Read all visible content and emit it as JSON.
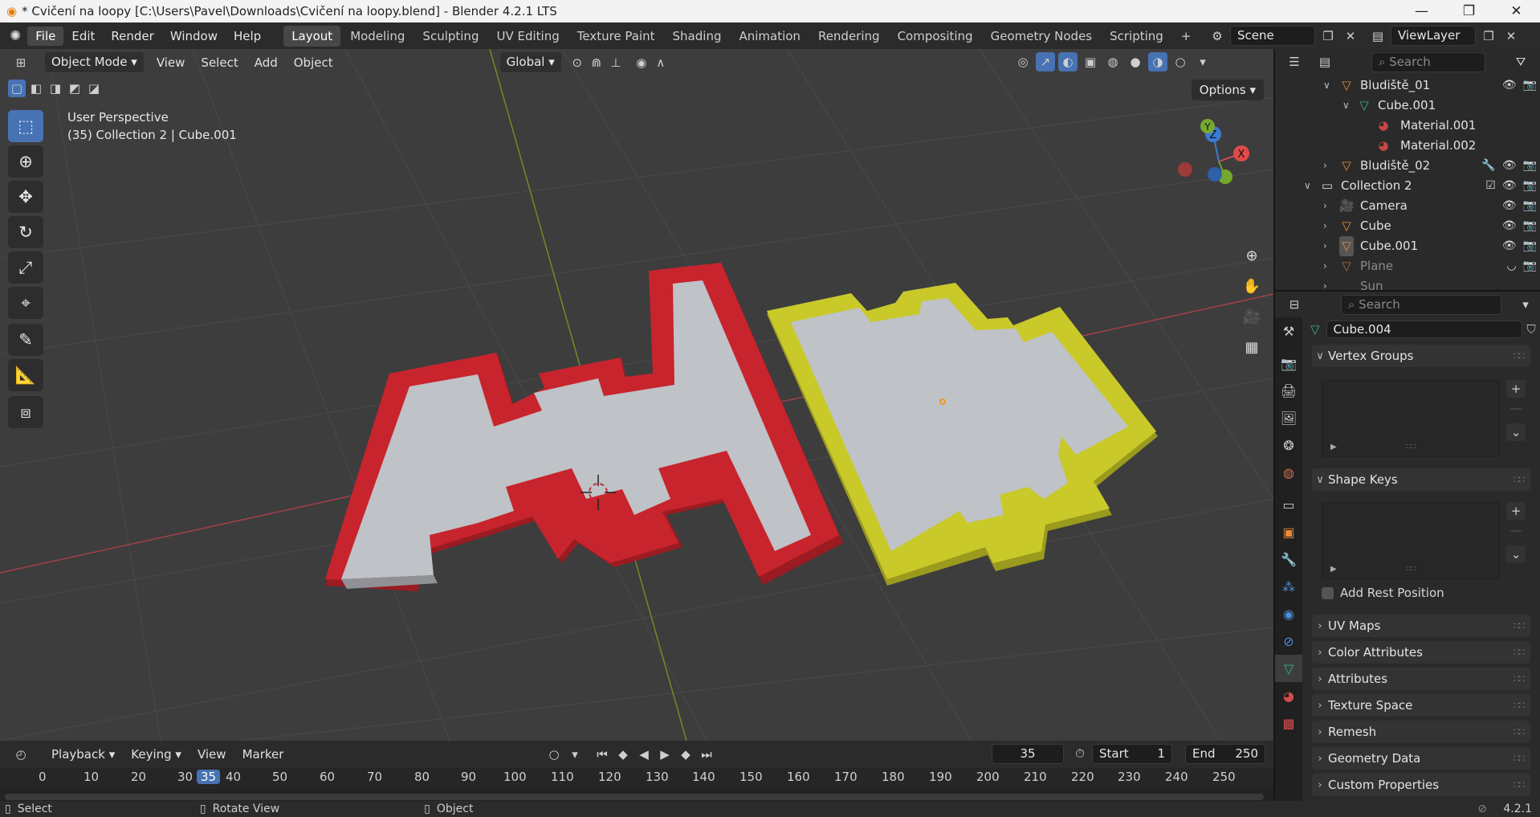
{
  "window": {
    "title": "* Cvičení na loopy [C:\\Users\\Pavel\\Downloads\\Cvičení na loopy.blend] - Blender 4.2.1 LTS",
    "minimize": "—",
    "maximize": "❐",
    "close": "✕"
  },
  "topbar": {
    "menus": [
      "File",
      "Edit",
      "Render",
      "Window",
      "Help"
    ],
    "workspaces": [
      "Layout",
      "Modeling",
      "Sculpting",
      "UV Editing",
      "Texture Paint",
      "Shading",
      "Animation",
      "Rendering",
      "Compositing",
      "Geometry Nodes",
      "Scripting"
    ],
    "add_workspace": "+",
    "scene": "Scene",
    "view_layer": "ViewLayer"
  },
  "viewport": {
    "mode": "Object Mode",
    "menus": [
      "View",
      "Select",
      "Add",
      "Object"
    ],
    "orientation": "Global",
    "options": "Options",
    "info_line1": "User Perspective",
    "info_line2": "(35) Collection 2 | Cube.001",
    "gizmo_labels": {
      "x": "X",
      "y": "Y",
      "z": "Z"
    }
  },
  "outliner": {
    "search_placeholder": "Search",
    "rows": [
      {
        "name": "Bludiště_01"
      },
      {
        "name": "Cube.001"
      },
      {
        "name": "Material.001"
      },
      {
        "name": "Material.002"
      },
      {
        "name": "Bludiště_02"
      },
      {
        "name": "Collection 2"
      },
      {
        "name": "Camera"
      },
      {
        "name": "Cube"
      },
      {
        "name": "Cube.001"
      },
      {
        "name": "Plane"
      },
      {
        "name": "Sun"
      }
    ]
  },
  "properties": {
    "search_placeholder": "Search",
    "datablock": "Cube.004",
    "panels": {
      "vertex_groups": "Vertex Groups",
      "shape_keys": "Shape Keys",
      "add_rest_position": "Add Rest Position",
      "uv_maps": "UV Maps",
      "color_attributes": "Color Attributes",
      "attributes": "Attributes",
      "texture_space": "Texture Space",
      "remesh": "Remesh",
      "geometry_data": "Geometry Data",
      "custom_properties": "Custom Properties"
    }
  },
  "timeline": {
    "menus": [
      "Playback",
      "Keying",
      "View",
      "Marker"
    ],
    "current_frame": "35",
    "start_label": "Start",
    "start": "1",
    "end_label": "End",
    "end": "250",
    "ticks": [
      "0",
      "10",
      "20",
      "30",
      "35",
      "40",
      "50",
      "60",
      "70",
      "80",
      "90",
      "100",
      "110",
      "120",
      "130",
      "140",
      "150",
      "160",
      "170",
      "180",
      "190",
      "200",
      "210",
      "220",
      "230",
      "240",
      "250"
    ]
  },
  "statusbar": {
    "select": "Select",
    "rotate": "Rotate View",
    "object": "Object",
    "version": "4.2.1"
  },
  "colors": {
    "red_object": "#c8242d",
    "yellow_object": "#c9c92a",
    "active_blue": "#4772b3"
  }
}
